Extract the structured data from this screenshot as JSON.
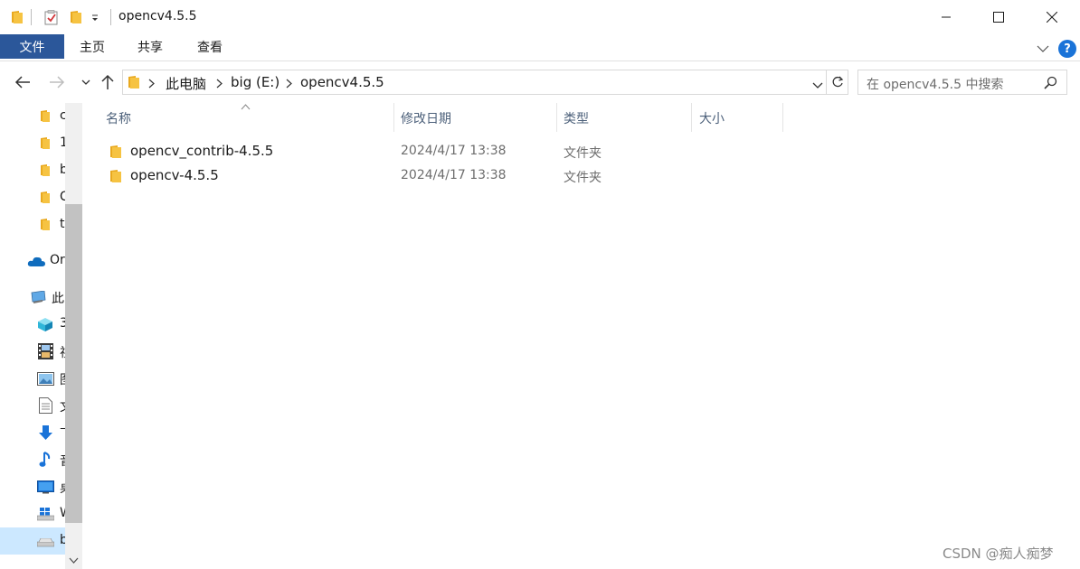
{
  "window": {
    "title": "opencv4.5.5"
  },
  "ribbon": {
    "tabs": [
      "文件",
      "主页",
      "共享",
      "查看"
    ]
  },
  "address_bar": {
    "crumbs": [
      "此电脑",
      "big (E:)",
      "opencv4.5.5"
    ]
  },
  "search": {
    "placeholder": "在 opencv4.5.5 中搜索"
  },
  "nav_pane": {
    "items": [
      {
        "icon": "folder-icon",
        "label": "c"
      },
      {
        "icon": "folder-icon",
        "label": "1"
      },
      {
        "icon": "folder-icon",
        "label": "b"
      },
      {
        "icon": "folder-icon",
        "label": "C"
      },
      {
        "icon": "folder-icon",
        "label": "t"
      },
      {
        "icon": "onedrive-icon",
        "label": "Or"
      },
      {
        "icon": "this-pc-icon",
        "label": "此"
      },
      {
        "icon": "3d-objects-icon",
        "label": "3"
      },
      {
        "icon": "videos-icon",
        "label": "视"
      },
      {
        "icon": "pictures-icon",
        "label": "图"
      },
      {
        "icon": "documents-icon",
        "label": "文"
      },
      {
        "icon": "downloads-icon",
        "label": "下"
      },
      {
        "icon": "music-icon",
        "label": "音"
      },
      {
        "icon": "desktop-icon",
        "label": "桌"
      },
      {
        "icon": "windows-drive-icon",
        "label": "W"
      },
      {
        "icon": "drive-icon",
        "label": "b"
      }
    ]
  },
  "columns": {
    "name": "名称",
    "date": "修改日期",
    "type": "类型",
    "size": "大小"
  },
  "files": [
    {
      "name": "opencv_contrib-4.5.5",
      "date": "2024/4/17 13:38",
      "type": "文件夹",
      "size": ""
    },
    {
      "name": "opencv-4.5.5",
      "date": "2024/4/17 13:38",
      "type": "文件夹",
      "size": ""
    }
  ],
  "watermark": "CSDN @痴人痴梦",
  "colors": {
    "file_tab": "#2b579a",
    "folder": "#f6c342",
    "help": "#1a73d8",
    "selection": "#cce8ff"
  }
}
